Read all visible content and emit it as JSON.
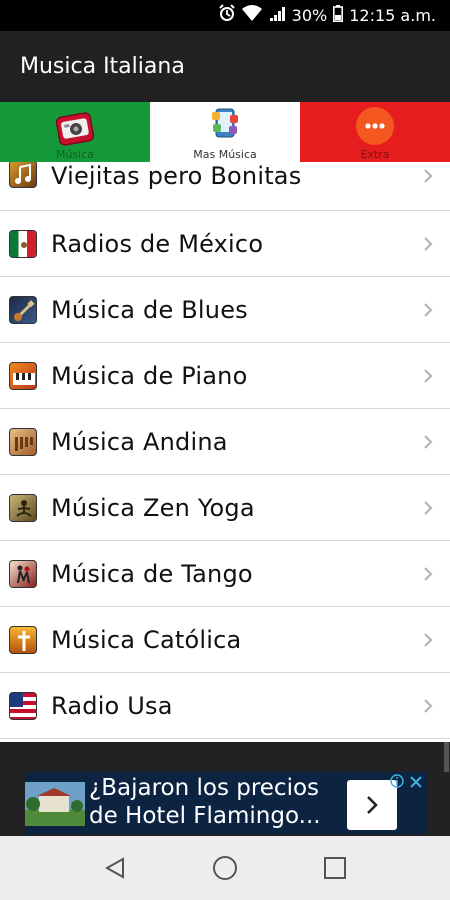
{
  "status_bar": {
    "battery": "30%",
    "time": "12:15 a.m."
  },
  "app_bar": {
    "title": "Musica Italiana"
  },
  "tabs": [
    {
      "label": "Música",
      "color": "#159a3b",
      "icon": "radio-icon"
    },
    {
      "label": "Mas Música",
      "color": "#ffffff",
      "icon": "music-apps-icon"
    },
    {
      "label": "Extra",
      "color": "#e51d1f",
      "icon": "more-dots-icon"
    }
  ],
  "list": {
    "items": [
      {
        "label": "Viejitas pero Bonitas",
        "icon": "vintage-music-icon"
      },
      {
        "label": "Radios de México",
        "icon": "mexico-flag-icon"
      },
      {
        "label": "Música de Blues",
        "icon": "guitar-icon"
      },
      {
        "label": "Música de Piano",
        "icon": "piano-icon"
      },
      {
        "label": "Música Andina",
        "icon": "andean-music-icon"
      },
      {
        "label": "Música Zen Yoga",
        "icon": "zen-yoga-icon"
      },
      {
        "label": "Música de Tango",
        "icon": "tango-icon"
      },
      {
        "label": "Música Católica",
        "icon": "catholic-icon"
      },
      {
        "label": "Radio Usa",
        "icon": "usa-flag-icon"
      }
    ]
  },
  "ad": {
    "line1": "¿Bajaron los precios",
    "line2": "de Hotel Flamingo..."
  },
  "colors": {
    "app_bar": "#212121",
    "italy_green": "#159a3b",
    "italy_red": "#e51d1f",
    "extra_orange": "#f4581e"
  }
}
